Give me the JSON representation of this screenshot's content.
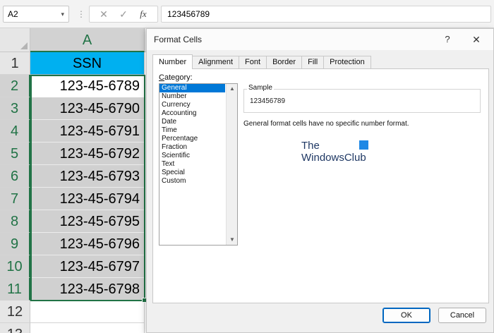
{
  "formula_bar": {
    "name_box": "A2",
    "name_box_chevron": "▾",
    "separator": "⋮",
    "cancel_symbol": "✕",
    "enter_symbol": "✓",
    "fx_symbol": "fx",
    "value": "123456789"
  },
  "sheet": {
    "column_a": "A",
    "rows": [
      {
        "num": "1",
        "value": "SSN"
      },
      {
        "num": "2",
        "value": "123-45-6789"
      },
      {
        "num": "3",
        "value": "123-45-6790"
      },
      {
        "num": "4",
        "value": "123-45-6791"
      },
      {
        "num": "5",
        "value": "123-45-6792"
      },
      {
        "num": "6",
        "value": "123-45-6793"
      },
      {
        "num": "7",
        "value": "123-45-6794"
      },
      {
        "num": "8",
        "value": "123-45-6795"
      },
      {
        "num": "9",
        "value": "123-45-6796"
      },
      {
        "num": "10",
        "value": "123-45-6797"
      },
      {
        "num": "11",
        "value": "123-45-6798"
      },
      {
        "num": "12",
        "value": ""
      },
      {
        "num": "13",
        "value": ""
      }
    ],
    "header_fill": "#00b0f0",
    "selection_color": "#217346"
  },
  "dialog": {
    "title": "Format Cells",
    "help": "?",
    "close": "✕",
    "tabs": [
      "Number",
      "Alignment",
      "Font",
      "Border",
      "Fill",
      "Protection"
    ],
    "active_tab": "Number",
    "category_label_first": "C",
    "category_label_rest": "ategory:",
    "categories": [
      "General",
      "Number",
      "Currency",
      "Accounting",
      "Date",
      "Time",
      "Percentage",
      "Fraction",
      "Scientific",
      "Text",
      "Special",
      "Custom"
    ],
    "selected_category": "General",
    "scroll_up": "▲",
    "scroll_down": "▼",
    "sample_label": "Sample",
    "sample_value": "123456789",
    "description": "General format cells have no specific number format.",
    "watermark_the": "The",
    "watermark_name": "WindowsClub",
    "ok": "OK",
    "cancel": "Cancel",
    "accent": "#0078d7"
  }
}
